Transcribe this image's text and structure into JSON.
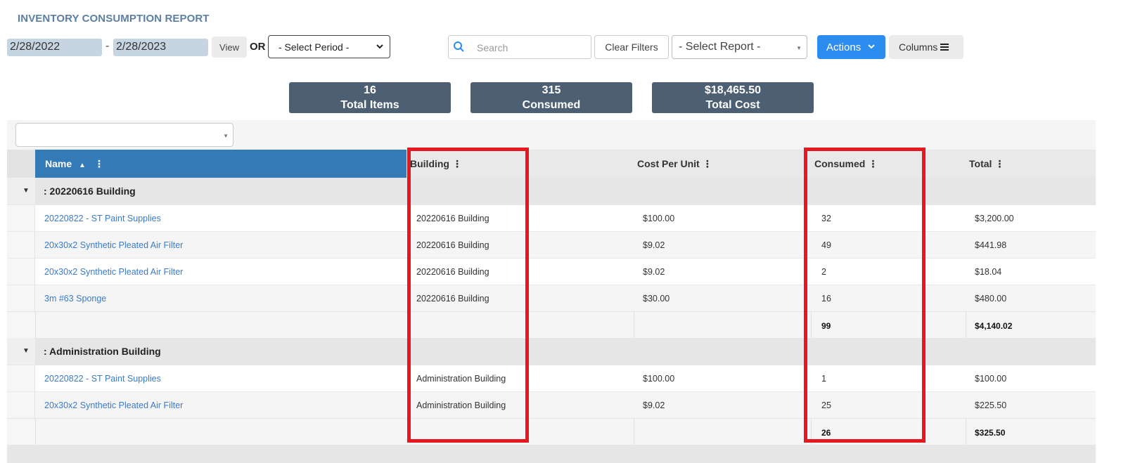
{
  "report": {
    "title": "INVENTORY CONSUMPTION REPORT"
  },
  "filters": {
    "date_from": "2/28/2022",
    "date_separator": "-",
    "date_to": "2/28/2023",
    "view_label": "View",
    "or_label": "OR",
    "period_placeholder": "- Select Period -",
    "search_placeholder": "Search",
    "clear_filters_label": "Clear Filters",
    "report_placeholder": "- Select Report -",
    "actions_label": "Actions",
    "columns_label": "Columns"
  },
  "stats": [
    {
      "value": "16",
      "label": "Total Items"
    },
    {
      "value": "315",
      "label": "Consumed"
    },
    {
      "value": "$18,465.50",
      "label": "Total Cost"
    }
  ],
  "table": {
    "columns": {
      "name": "Name",
      "building": "Building",
      "cost_per_unit": "Cost Per Unit",
      "consumed": "Consumed",
      "total": "Total"
    },
    "sort_indicator": "▲",
    "groups": [
      {
        "label": ": 20220616 Building",
        "rows": [
          {
            "name": "20220822 - ST Paint Supplies",
            "building": "20220616 Building",
            "cost_per_unit": "$100.00",
            "consumed": "32",
            "total": "$3,200.00"
          },
          {
            "name": "20x30x2 Synthetic Pleated Air Filter",
            "building": "20220616 Building",
            "cost_per_unit": "$9.02",
            "consumed": "49",
            "total": "$441.98"
          },
          {
            "name": "20x30x2 Synthetic Pleated Air Filter",
            "building": "20220616 Building",
            "cost_per_unit": "$9.02",
            "consumed": "2",
            "total": "$18.04"
          },
          {
            "name": "3m #63 Sponge",
            "building": "20220616 Building",
            "cost_per_unit": "$30.00",
            "consumed": "16",
            "total": "$480.00"
          }
        ],
        "summary": {
          "consumed": "99",
          "total": "$4,140.02"
        }
      },
      {
        "label": ": Administration Building",
        "rows": [
          {
            "name": "20220822 - ST Paint Supplies",
            "building": "Administration Building",
            "cost_per_unit": "$100.00",
            "consumed": "1",
            "total": "$100.00"
          },
          {
            "name": "20x30x2 Synthetic Pleated Air Filter",
            "building": "Administration Building",
            "cost_per_unit": "$9.02",
            "consumed": "25",
            "total": "$225.50"
          }
        ],
        "summary": {
          "consumed": "26",
          "total": "$325.50"
        }
      }
    ]
  },
  "colors": {
    "header_blue": "#337ab7",
    "actions_blue": "#2d8cf0",
    "stat_bg": "#4d5f73",
    "highlight_red": "#e8161f",
    "link_blue": "#3a7bc8"
  },
  "icons": [
    "search-icon",
    "chevron-down-icon",
    "menu-icon",
    "kebab-icon",
    "collapse-toggle-icon",
    "sort-asc-icon"
  ]
}
